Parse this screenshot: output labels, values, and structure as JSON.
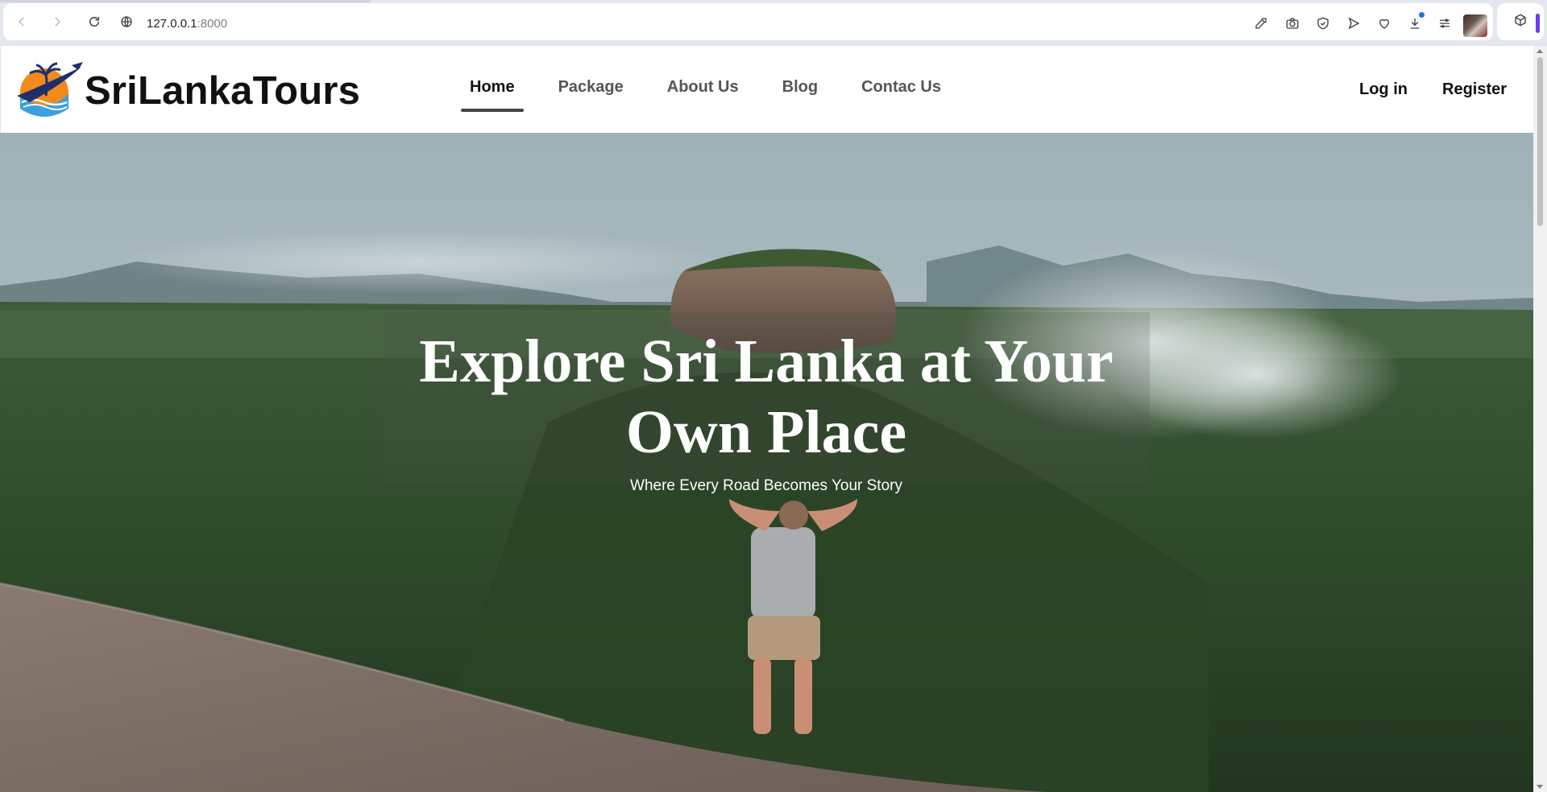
{
  "browser": {
    "url_host": "127.0.0.1",
    "url_port": ":8000",
    "icons": [
      "back-icon",
      "forward-icon",
      "reload-icon",
      "site-info-icon",
      "edit-icon",
      "camera-icon",
      "shield-icon",
      "send-icon",
      "heart-icon",
      "download-icon",
      "menu-icon",
      "extensions-icon"
    ]
  },
  "site": {
    "brand": "SriLankaTours",
    "menu": [
      {
        "label": "Home",
        "active": true
      },
      {
        "label": "Package",
        "active": false
      },
      {
        "label": "About Us",
        "active": false
      },
      {
        "label": "Blog",
        "active": false
      },
      {
        "label": "Contac Us",
        "active": false
      }
    ],
    "login_label": "Log in",
    "register_label": "Register"
  },
  "hero": {
    "title_line1": "Explore Sri Lanka at Your",
    "title_line2": "Own Place",
    "subtitle": "Where Every Road Becomes Your Story"
  },
  "colors": {
    "accent_purple": "#6b3cf5",
    "logo_orange": "#f28a1c",
    "logo_navy": "#1f2f6b",
    "logo_sky": "#3aa0e0"
  }
}
